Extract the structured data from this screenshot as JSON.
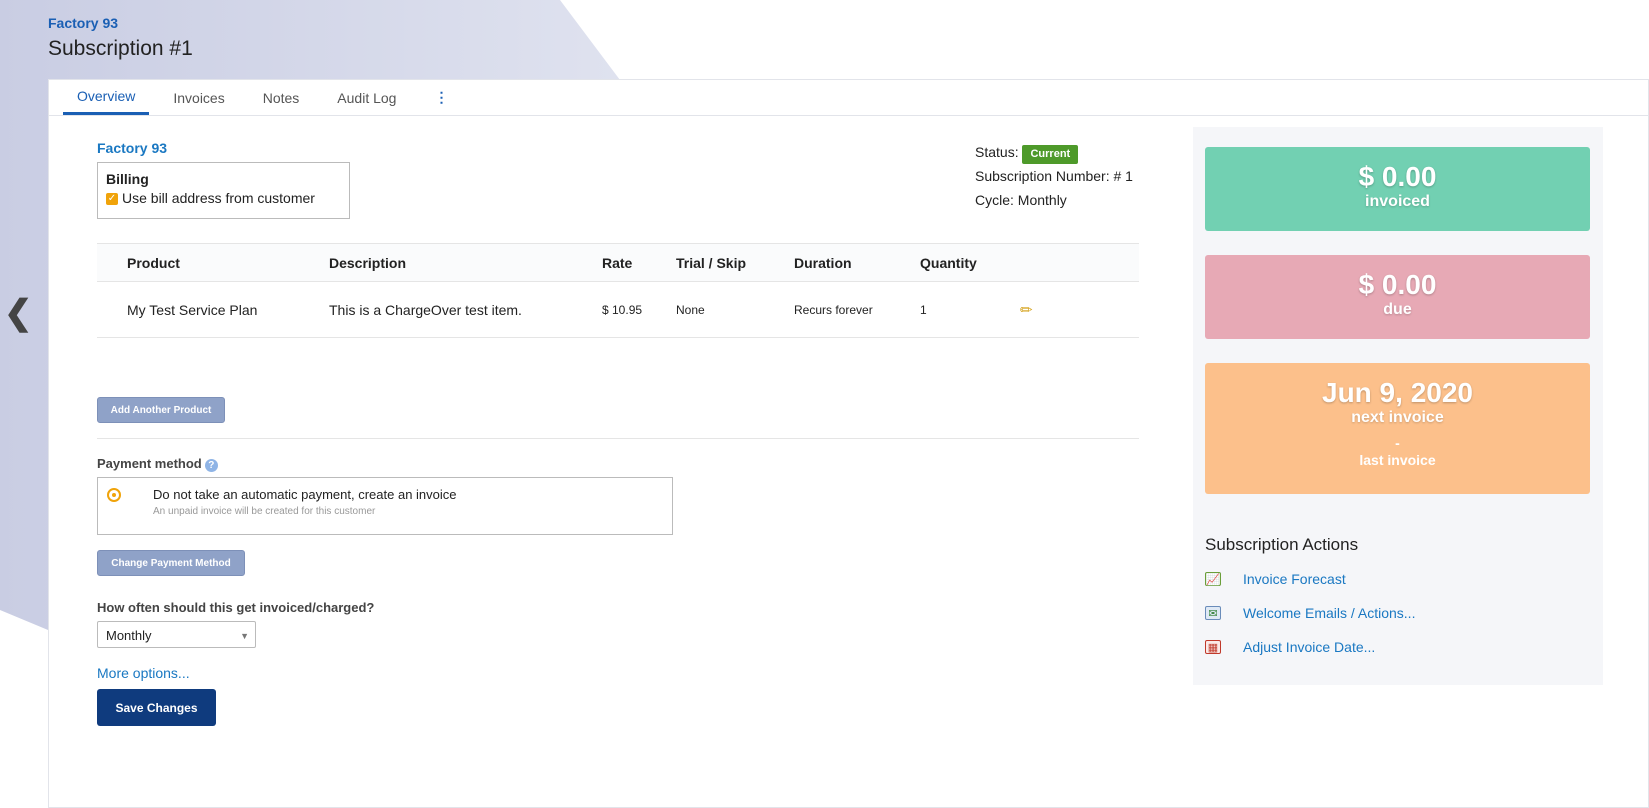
{
  "header": {
    "breadcrumb": "Factory 93",
    "title": "Subscription #1"
  },
  "nav": {
    "back_icon": "❮"
  },
  "tabs": [
    {
      "label": "Overview"
    },
    {
      "label": "Invoices"
    },
    {
      "label": "Notes"
    },
    {
      "label": "Audit Log"
    },
    {
      "label": "⋮"
    }
  ],
  "customer": {
    "name": "Factory 93",
    "billing_title": "Billing",
    "billing_checkbox_label": "Use bill address from customer"
  },
  "status": {
    "label": "Status:",
    "value": "Current",
    "sub_number": "Subscription Number: # 1",
    "cycle": "Cycle: Monthly",
    "badge_color": "#4e9a2a"
  },
  "table": {
    "columns": [
      "Product",
      "Description",
      "Rate",
      "Trial / Skip",
      "Duration",
      "Quantity"
    ],
    "rows": [
      {
        "product": "My Test Service Plan",
        "description": "This is a ChargeOver test item.",
        "rate": "$ 10.95",
        "trial": "None",
        "duration": "Recurs forever",
        "quantity": "1"
      }
    ]
  },
  "buttons": {
    "add_product": "Add Another Product",
    "change_payment": "Change Payment Method",
    "save": "Save Changes"
  },
  "payment": {
    "label": "Payment method",
    "help_icon": "?",
    "option_title": "Do not take an automatic payment, create an invoice",
    "option_sub": "An unpaid invoice will be created for this customer"
  },
  "frequency": {
    "label": "How often should this get invoiced/charged?",
    "selected": "Monthly"
  },
  "more_options": "More options...",
  "summary": {
    "invoiced_amount": "$ 0.00",
    "invoiced_label": "invoiced",
    "due_amount": "$ 0.00",
    "due_label": "due",
    "next_invoice_date": "Jun 9, 2020",
    "next_invoice_label": "next invoice",
    "last_invoice_value": "-",
    "last_invoice_label": "last invoice",
    "colors": {
      "invoiced": "#72d0b2",
      "due": "#e7a9b5",
      "next": "#fcc08b"
    }
  },
  "actions": {
    "title": "Subscription Actions",
    "items": [
      {
        "label": "Invoice Forecast",
        "icon": "chart-icon"
      },
      {
        "label": "Welcome Emails / Actions...",
        "icon": "email-icon"
      },
      {
        "label": "Adjust Invoice Date...",
        "icon": "calendar-icon"
      }
    ]
  }
}
